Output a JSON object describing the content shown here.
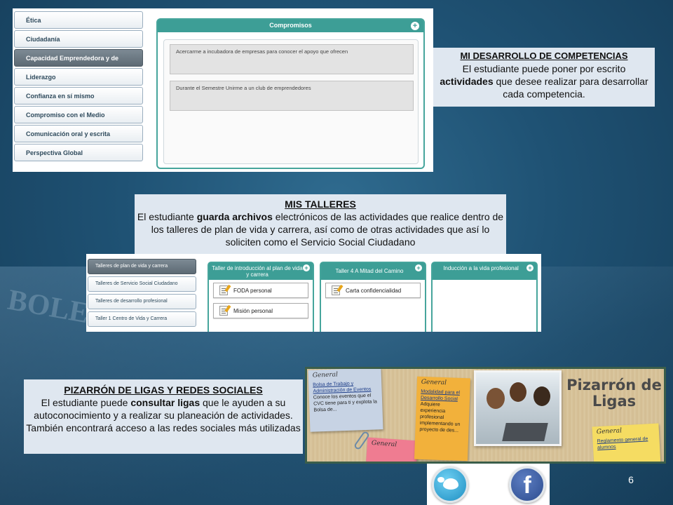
{
  "competencias": {
    "sidebar": [
      "Ética",
      "Ciudadanía",
      "Capacidad Emprendedora y de",
      "Liderazgo",
      "Confianza en sí mismo",
      "Compromiso con el Medio",
      "Comunicación oral y escrita",
      "Perspectiva Global"
    ],
    "active_index": 2,
    "box_title": "Compromisos",
    "add_symbol": "+",
    "notes": [
      "Acercarme a incubadora de empresas para conocer el apoyo que ofrecen",
      "Durante el Semestre Unirme a un club de emprendedores"
    ]
  },
  "caption1": {
    "title": "MI DESARROLLO DE COMPETENCIAS",
    "p1": "El estudiante puede poner por escrito",
    "bold": "actividades",
    "p2": " que desee realizar para desarrollar cada competencia."
  },
  "caption2": {
    "title": "MIS TALLERES",
    "p1": "El estudiante ",
    "bold": "guarda archivos",
    "p2": " electrónicos de las actividades que realice dentro de los talleres de plan de vida y carrera, así como de otras actividades que así lo soliciten como el Servicio Social Ciudadano"
  },
  "talleres": {
    "sidebar": [
      "Talleres de plan de vida y carrera",
      "Talleres de Servicio Social Ciudadano",
      "Talleres de desarrollo profesional",
      "Taller 1 Centro de Vida y Carrera"
    ],
    "active_index": 0,
    "columns": [
      {
        "title": "Taller de introducción al plan de vida y carrera",
        "files": [
          "FODA personal",
          "Misión personal"
        ]
      },
      {
        "title": "Taller 4 A Mitad del Camino",
        "files": [
          "Carta confidencialidad"
        ]
      },
      {
        "title": "Inducción a la vida profesional",
        "files": []
      }
    ]
  },
  "caption3": {
    "title": "PIZARRÓN DE LIGAS Y REDES SOCIALES",
    "p1": "El estudiante puede ",
    "bold": "consultar ligas",
    "p2": " que le ayuden a su autoconocimiento y a realizar su planeación de actividades. También encontrará acceso a las redes sociales más utilizadas"
  },
  "pizarron": {
    "title": "Pizarrón de Ligas",
    "note_blue": {
      "head": "General",
      "link": "Bolsa de Trabajo y Administración de Eventos",
      "text": "Conoce los eventos que el CVC tiene para ti y explota la Bolsa de..."
    },
    "note_orange": {
      "head": "General",
      "link": "Modalidad para el Desarrollo Social",
      "text": "Adquiere experiencia profesional implementando un proyecto de des..."
    },
    "note_pink": {
      "head": "General"
    },
    "note_yellow": {
      "head": "General",
      "link": "Reglamento general de alumnos"
    }
  },
  "social": {
    "twitter": "twitter-icon",
    "facebook": "f"
  },
  "page_number": "6"
}
